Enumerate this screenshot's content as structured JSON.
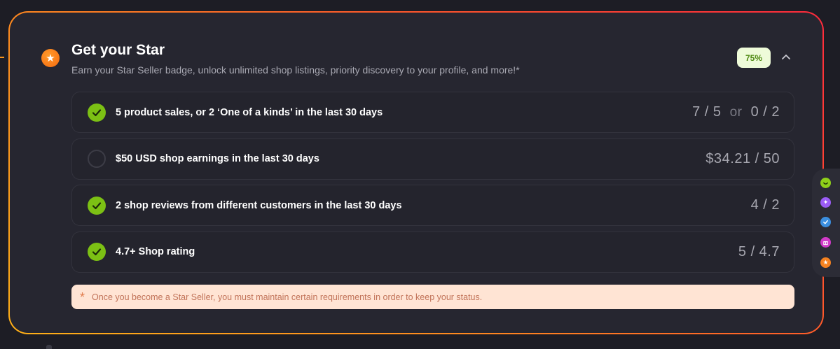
{
  "header": {
    "title": "Get your Star",
    "subtitle": "Earn your Star Seller badge, unlock unlimited shop listings, priority discovery to your profile, and more!*",
    "progress_label": "75%",
    "progress_fraction": 0.75,
    "star_icon": "star-icon",
    "collapse_icon": "chevron-up-icon"
  },
  "requirements": [
    {
      "label": "5 product sales, or 2 ‘One of a kinds’ in the last 30 days",
      "value_a": "7 / 5",
      "or_text": "or",
      "value_b": "0 / 2",
      "done": true
    },
    {
      "label": "$50 USD shop earnings in the last 30 days",
      "value": "$34.21 / 50",
      "done": false
    },
    {
      "label": "2 shop reviews from different customers in the last 30 days",
      "value": "4 / 2",
      "done": true
    },
    {
      "label": "4.7+ Shop rating",
      "value": "5 / 4.7",
      "done": true
    }
  ],
  "note": {
    "icon": "asterisk-icon",
    "text": "Once you become a Star Seller, you must maintain certain requirements in order to keep your status."
  },
  "side_rail": {
    "items": [
      {
        "icon": "smile-icon",
        "color": "#8fd01a"
      },
      {
        "icon": "sparkle-icon",
        "color": "#9b5cf6"
      },
      {
        "icon": "check-icon",
        "color": "#3b8fe0"
      },
      {
        "icon": "gift-icon",
        "color": "#d13ac8"
      },
      {
        "icon": "star-icon",
        "color": "#f58220"
      }
    ]
  },
  "colors": {
    "accent_orange": "#f7941d",
    "accent_red": "#ff2a3c",
    "success_green": "#7cc014",
    "card_bg": "#262630"
  }
}
